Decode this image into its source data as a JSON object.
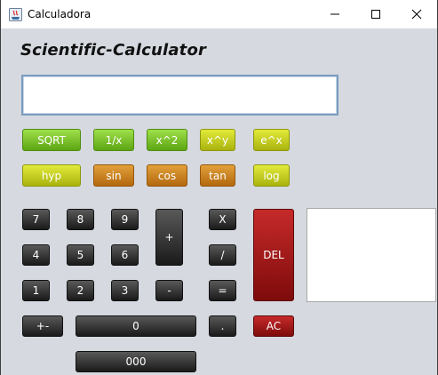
{
  "window": {
    "title": "Calculadora"
  },
  "header": {
    "title": "Scientific-Calculator"
  },
  "display": {
    "value": ""
  },
  "function_row": [
    "SQRT",
    "1/x",
    "x^2",
    "x^y",
    "e^x"
  ],
  "trig_row": [
    "hyp",
    "sin",
    "cos",
    "tan",
    "log"
  ],
  "digits": {
    "seven": "7",
    "eight": "8",
    "nine": "9",
    "four": "4",
    "five": "5",
    "six": "6",
    "one": "1",
    "two": "2",
    "three": "3",
    "zero": "0",
    "triple_zero": "000"
  },
  "operators": {
    "plus": "+",
    "minus": "-",
    "multiply": "X",
    "divide": "/",
    "equals": "=",
    "decimal": ".",
    "sign": "+-"
  },
  "controls": {
    "delete": "DEL",
    "all_clear": "AC"
  },
  "colors": {
    "background": "#d6d9e0",
    "green": "#7fc52e",
    "yellow": "#c9d224",
    "orange": "#c98324",
    "black": "#2a2a2a",
    "red": "#a51515"
  }
}
